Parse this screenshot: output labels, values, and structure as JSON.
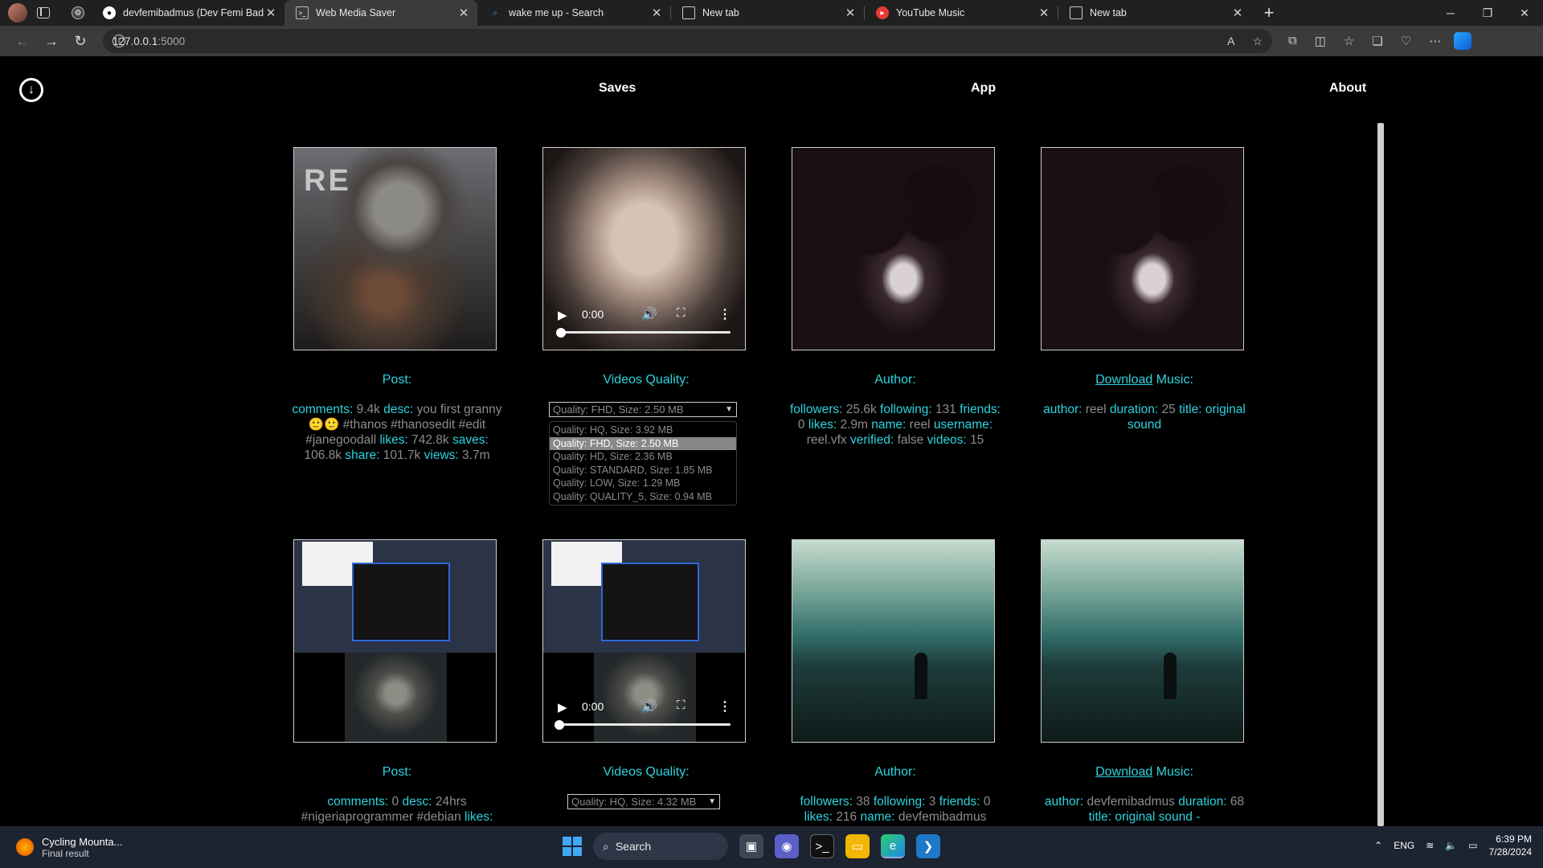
{
  "browser": {
    "tabs": [
      {
        "title": "devfemibadmus (Dev Femi Badmus)",
        "favicon": "github-icon",
        "active": false
      },
      {
        "title": "Web Media Saver",
        "favicon": "terminal-icon",
        "active": true
      },
      {
        "title": "wake me up - Search",
        "favicon": "search-icon",
        "active": false
      },
      {
        "title": "New tab",
        "favicon": "newtab-icon",
        "active": false
      },
      {
        "title": "YouTube Music",
        "favicon": "youtube-music-icon",
        "active": false
      },
      {
        "title": "New tab",
        "favicon": "newtab-icon",
        "active": false
      }
    ],
    "url_host": "127.0.0.1",
    "url_port": ":5000"
  },
  "nav": {
    "saves": "Saves",
    "app": "App",
    "about": "About"
  },
  "row1": {
    "post": {
      "heading": "Post:",
      "comments_label": "comments:",
      "comments": "9.4k",
      "desc_label": "desc:",
      "desc": "you first granny 🙂🙂 #thanos #thanosedit #edit #janegoodall",
      "likes_label": "likes:",
      "likes": "742.8k",
      "saves_label": "saves:",
      "saves": "106.8k",
      "share_label": "share:",
      "share": "101.7k",
      "views_label": "views:",
      "views": "3.7m"
    },
    "video": {
      "heading": "Videos Quality:",
      "time": "0:00",
      "selected": "Quality: FHD, Size: 2.50 MB",
      "options": [
        "Quality: HQ, Size: 3.92 MB",
        "Quality: FHD, Size: 2.50 MB",
        "Quality: HD, Size: 2.36 MB",
        "Quality: STANDARD, Size: 1.85 MB",
        "Quality: LOW, Size: 1.29 MB",
        "Quality: QUALITY_5, Size: 0.94 MB"
      ]
    },
    "author": {
      "heading": "Author:",
      "followers_label": "followers:",
      "followers": "25.6k",
      "following_label": "following:",
      "following": "131",
      "friends_label": "friends:",
      "friends": "0",
      "likes_label": "likes:",
      "likes": "2.9m",
      "name_label": "name:",
      "name": "reel",
      "username_label": "username:",
      "username": "reel.vfx",
      "verified_label": "verified:",
      "verified": "false",
      "videos_label": "videos:",
      "videos": "15"
    },
    "music": {
      "heading_link": "Download",
      "heading_rest": " Music:",
      "author_label": "author:",
      "author": "reel",
      "duration_label": "duration:",
      "duration": "25",
      "title_label": "title:",
      "title": "original sound"
    }
  },
  "row2": {
    "post": {
      "heading": "Post:",
      "comments_label": "comments:",
      "comments": "0",
      "desc_label": "desc:",
      "desc": "24hrs #nigeriaprogrammer #debian",
      "likes_label": "likes:"
    },
    "video": {
      "heading": "Videos Quality:",
      "time": "0:00",
      "selected": "Quality: HQ, Size: 4.32 MB"
    },
    "author": {
      "heading": "Author:",
      "followers_label": "followers:",
      "followers": "38",
      "following_label": "following:",
      "following": "3",
      "friends_label": "friends:",
      "friends": "0",
      "likes_label": "likes:",
      "likes": "216",
      "name_label": "name:",
      "name": "devfemibadmus"
    },
    "music": {
      "heading_link": "Download",
      "heading_rest": " Music:",
      "author_label": "author:",
      "author": "devfemibadmus",
      "duration_label": "duration:",
      "duration": "68",
      "title_label": "title:",
      "title": "original sound -"
    }
  },
  "taskbar": {
    "weather_title": "Cycling Mounta...",
    "weather_sub": "Final result",
    "search": "Search",
    "lang": "ENG",
    "time": "6:39 PM",
    "date": "7/28/2024"
  }
}
